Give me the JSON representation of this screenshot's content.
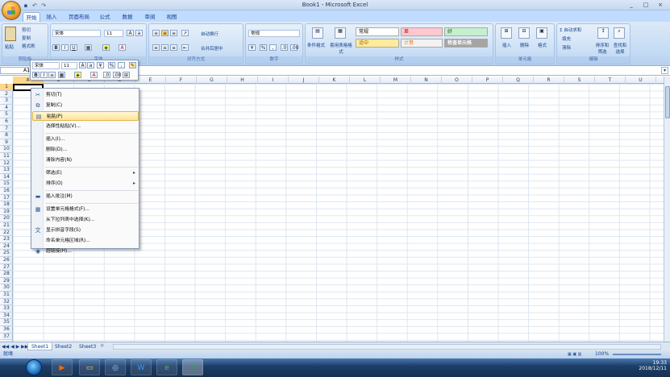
{
  "window": {
    "title": "Book1 - Microsoft Excel",
    "qat_icons": [
      "save-icon",
      "undo-icon",
      "redo-icon"
    ],
    "controls": [
      "_",
      "□",
      "×"
    ]
  },
  "tabs": [
    "开始",
    "插入",
    "页面布局",
    "公式",
    "数据",
    "审阅",
    "视图"
  ],
  "ribbon": {
    "clipboard": {
      "paste": "粘贴",
      "cut": "剪切",
      "copy": "复制",
      "format_painter": "格式刷",
      "label": "剪贴板"
    },
    "font": {
      "name": "宋体",
      "size": "11",
      "label": "字体"
    },
    "alignment": {
      "wrap": "自动换行",
      "merge": "合并后居中",
      "label": "对齐方式"
    },
    "number": {
      "format": "常规",
      "label": "数字"
    },
    "styles": {
      "cond": "条件格式",
      "table": "套用表格格式",
      "cells": [
        {
          "text": "常规",
          "bg": "#ffffff"
        },
        {
          "text": "差",
          "bg": "#ffc7ce"
        },
        {
          "text": "好",
          "bg": "#c6efce"
        },
        {
          "text": "适中",
          "bg": "#ffeb9c"
        },
        {
          "text": "计算",
          "bg": "#f2f2f2"
        },
        {
          "text": "检查单元格",
          "bg": "#a5a5a5"
        }
      ],
      "label": "样式"
    },
    "cells_group": {
      "insert": "插入",
      "delete": "删除",
      "format": "格式",
      "label": "单元格"
    },
    "editing": {
      "autosum": "Σ 自动求和",
      "fill": "填充",
      "clear": "清除",
      "sort": "排序和筛选",
      "find": "查找和选择",
      "label": "编辑"
    }
  },
  "formula_bar": {
    "name_box": "A1",
    "fx": "fx"
  },
  "columns": [
    "A",
    "B",
    "C",
    "D",
    "E",
    "F",
    "G",
    "H",
    "I",
    "J",
    "K",
    "L",
    "M",
    "N",
    "O",
    "P",
    "Q",
    "R",
    "S",
    "T",
    "U",
    "V"
  ],
  "rows": [
    "1",
    "2",
    "3",
    "4",
    "5",
    "6",
    "7",
    "8",
    "9",
    "10",
    "11",
    "12",
    "13",
    "14",
    "15",
    "16",
    "17",
    "18",
    "19",
    "20",
    "21",
    "22",
    "23",
    "24",
    "25",
    "26",
    "27",
    "28",
    "29",
    "30",
    "31",
    "32",
    "33",
    "34",
    "35",
    "36",
    "37"
  ],
  "mini_toolbar": {
    "font": "宋体",
    "size": "11"
  },
  "context_menu": [
    {
      "label": "剪切(T)",
      "icon": "scissors-icon"
    },
    {
      "label": "复制(C)",
      "icon": "copy-icon"
    },
    {
      "label": "粘贴(P)",
      "icon": "paste-icon",
      "highlight": true
    },
    {
      "label": "选择性粘贴(V)...",
      "icon": ""
    },
    {
      "sep": true
    },
    {
      "label": "插入(I)...",
      "icon": ""
    },
    {
      "label": "删除(D)...",
      "icon": ""
    },
    {
      "label": "清除内容(N)",
      "icon": ""
    },
    {
      "sep": true
    },
    {
      "label": "筛选(E)",
      "icon": "",
      "submenu": true
    },
    {
      "label": "排序(O)",
      "icon": "",
      "submenu": true
    },
    {
      "sep": true
    },
    {
      "label": "插入批注(M)",
      "icon": "comment-icon"
    },
    {
      "sep": true
    },
    {
      "label": "设置单元格格式(F)...",
      "icon": "format-cells-icon"
    },
    {
      "label": "从下拉列表中选择(K)...",
      "icon": ""
    },
    {
      "label": "显示拼音字段(S)",
      "icon": "phonetic-icon"
    },
    {
      "label": "命名单元格区域(R)...",
      "icon": ""
    },
    {
      "label": "超链接(H)...",
      "icon": "hyperlink-icon"
    }
  ],
  "sheets": [
    "Sheet1",
    "Sheet2",
    "Sheet3"
  ],
  "status": {
    "ready": "就绪",
    "zoom": "100%"
  },
  "clock": {
    "time": "19:33",
    "date": "2018/12/11"
  }
}
